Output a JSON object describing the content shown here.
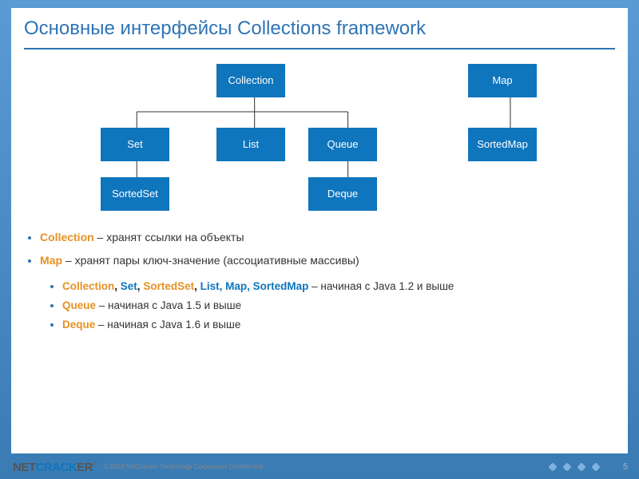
{
  "title": "Основные интерфейсы Collections framework",
  "diagram": {
    "collection": "Collection",
    "set": "Set",
    "list": "List",
    "queue": "Queue",
    "sortedset": "SortedSet",
    "deque": "Deque",
    "map": "Map",
    "sortedmap": "SortedMap"
  },
  "bullet1_kw": "Collection",
  "bullet1_text": " – хранят ссылки на объекты",
  "bullet2_kw": "Map",
  "bullet2_text": " – хранят пары ключ-значение (ассоциативные массивы)",
  "sub1_kw1": "Collection",
  "sub1_kw2": "Set",
  "sub1_kw3": "SortedSet",
  "sub1_kw4": "List, Map, SortedMap",
  "sub1_text": " – начиная с Java 1.2 и выше",
  "sub2_kw": "Queue",
  "sub2_text": " – начиная с Java 1.5 и выше",
  "sub3_kw": "Deque",
  "sub3_text": " – начиная с Java 1.6 и выше",
  "footer": {
    "logo_net": "NET",
    "logo_crack": "CRACK",
    "logo_er": "ER",
    "copyright": "© 2013 NetCracker Technology Corporation Confidential",
    "page": "5"
  }
}
